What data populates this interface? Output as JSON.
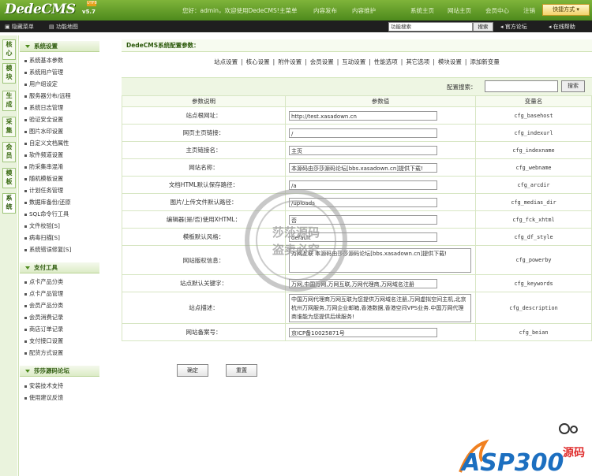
{
  "header": {
    "logo": "DedeCMS",
    "version": "v5.7",
    "version_badge": "UTF8",
    "welcome": "您好：admin，欢迎使用DedeCMS!",
    "nav": [
      "主菜单",
      "内容发布",
      "内容维护",
      "系统主页",
      "网站主页",
      "会员中心",
      "注销"
    ],
    "quick": "快捷方式"
  },
  "subbar": {
    "hide_menu": "隐藏菜单",
    "func_map": "功能地图",
    "search_value": "功能搜索",
    "search_btn": "搜索",
    "forum": "官方论坛",
    "help": "在线帮助"
  },
  "vtabs": [
    "核心",
    "模块",
    "生成",
    "采集",
    "会员",
    "模板",
    "系统"
  ],
  "sidebar": {
    "group1": {
      "title": "系统设置",
      "items": [
        "系统基本参数",
        "系统用户管理",
        "用户组设定",
        "服务器分布/远程",
        "系统日志管理",
        "验证安全设置",
        "图片水印设置",
        "自定义文档属性",
        "软件频道设置",
        "防采集串混淆",
        "随机模板设置",
        "计划任务管理",
        "数据库备份/还原",
        "SQL命令行工具",
        "文件校验[S]",
        "病毒扫描[S]",
        "系统错误修复[S]"
      ]
    },
    "group2": {
      "title": "支付工具",
      "items": [
        "点卡产品分类",
        "点卡产品管理",
        "会员产品分类",
        "会员消费记录",
        "商店订单记录",
        "支付接口设置",
        "配货方式设置"
      ]
    },
    "group3": {
      "title": "莎莎源码论坛",
      "items": [
        "安装技术支持",
        "使用建议反馈"
      ]
    }
  },
  "main": {
    "title": "DedeCMS系统配置参数：",
    "tabs": [
      "站点设置",
      "核心设置",
      "附件设置",
      "会员设置",
      "互动设置",
      "性能选项",
      "其它选项",
      "模块设置",
      "添加新变量"
    ],
    "config_search_label": "配置搜索：",
    "config_search_btn": "搜索",
    "col_headers": [
      "参数说明",
      "参数值",
      "变量名"
    ],
    "rows": [
      {
        "label": "站点根网址：",
        "value": "http://test.xasadown.cn",
        "var": "cfg_basehost"
      },
      {
        "label": "网页主页链接：",
        "value": "/",
        "var": "cfg_indexurl"
      },
      {
        "label": "主页链接名：",
        "value": "主页",
        "var": "cfg_indexname"
      },
      {
        "label": "网站名称：",
        "value": "本源码由莎莎源码论坛[bbs.xasadown.cn]提供下载!",
        "var": "cfg_webname"
      },
      {
        "label": "文档HTML默认保存路径：",
        "value": "/a",
        "var": "cfg_arcdir"
      },
      {
        "label": "图片/上传文件默认路径：",
        "value": "/uploads",
        "var": "cfg_medias_dir"
      },
      {
        "label": "编辑器(是/否)使用XHTML：",
        "value": "否",
        "var": "cfg_fck_xhtml"
      },
      {
        "label": "模板默认风格：",
        "value": "default",
        "var": "cfg_df_style"
      },
      {
        "label": "网站版权信息：",
        "value": "万网互联  本源码由莎莎源码论坛[bbs.xasadown.cn]提供下载!",
        "var": "cfg_powerby"
      },
      {
        "label": "站点默认关键字：",
        "value": "万网,中国万网,万网互联,万网代理商,万网域名注册",
        "var": "cfg_keywords"
      },
      {
        "label": "站点描述：",
        "value": "中国万网代理商万网互联为您提供万网域名注册,万网虚拟空间主机,北京杭州万网服务,万网企业邮箱,香港数据,香港空间VPS业务.中国万网代理商谁能为您提供后续服务!",
        "var": "cfg_description"
      },
      {
        "label": "网站备案号：",
        "value": "京ICP备10025871号",
        "var": "cfg_beian"
      }
    ],
    "ok_btn": "确定",
    "reset_btn": "重置"
  },
  "watermark": {
    "line1": "莎莎源码",
    "line2": "盗卖必究",
    "ring": "旺旺: 莎莎源码网"
  },
  "footer_logo": {
    "text": "ASP300",
    "sub": "源码"
  }
}
